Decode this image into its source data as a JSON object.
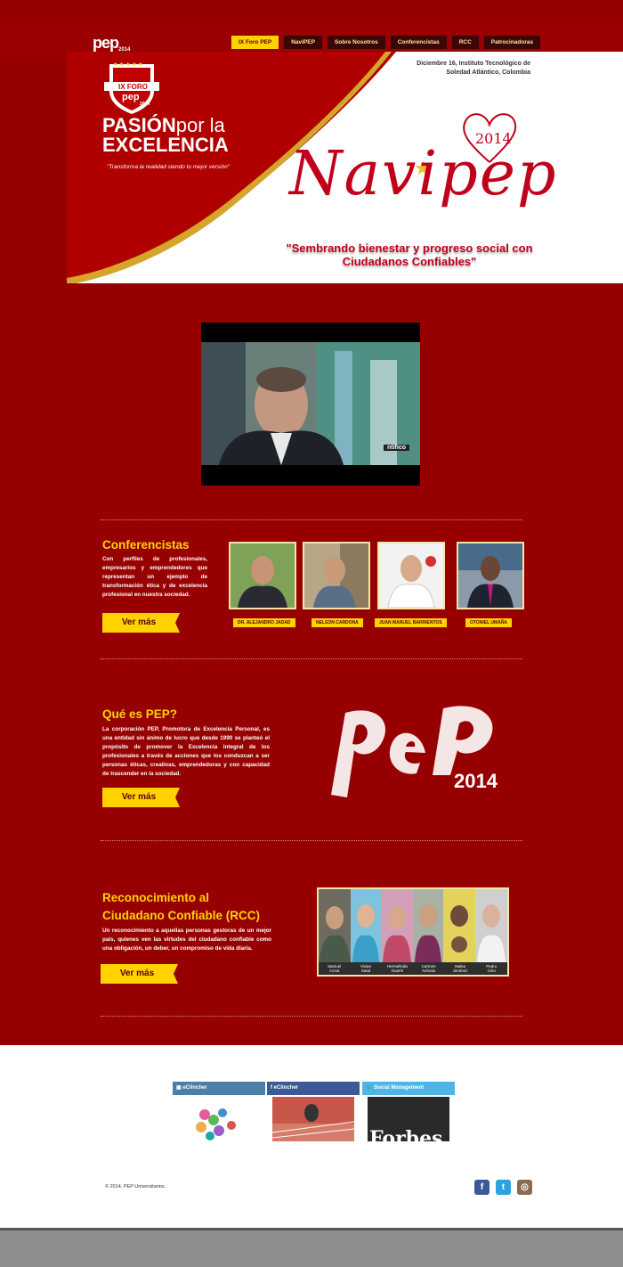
{
  "header": {
    "logo_text": "pep",
    "logo_year": "2014",
    "nav": [
      {
        "label": "IX Foro PEP",
        "active": true
      },
      {
        "label": "NaviPEP",
        "active": false
      },
      {
        "label": "Sobre Nosotros",
        "active": false
      },
      {
        "label": "Conferencistas",
        "active": false
      },
      {
        "label": "RCC",
        "active": false
      },
      {
        "label": "Patrocinadoras",
        "active": false
      }
    ]
  },
  "hero": {
    "badge_text": "IX FORO",
    "badge_pep": "pep",
    "badge_year": "2014",
    "title_bold_1": "PASIÓN",
    "title_light": "por la",
    "title_bold_2": "EXCELENCIA",
    "subtitle": "\"Transforma la realidad siendo tu mejor versión\"",
    "date_line_1": "Diciembre 16, Instituto Tecnológico de",
    "date_line_2": "Soledad Atlántico, Colombia",
    "event_name": "Navipep",
    "event_year": "2014",
    "slogan_line_1": "\"Sembrando bienestar y progreso social con",
    "slogan_line_2": "Ciudadanos Confiables\""
  },
  "video": {
    "caption": "ntífico"
  },
  "conferencistas": {
    "title": "Conferencistas",
    "text": "Con perfiles de profesionales, empresarios y emprendedores que representan un ejemplo de transformación ética y de excelencia profesional en nuestra sociedad.",
    "button": "Ver más",
    "speakers": [
      {
        "name": "DR. ALEJANDRO JADAD"
      },
      {
        "name": "NELSON CARDONA"
      },
      {
        "name": "JUAN MANUEL BARRIENTOS"
      },
      {
        "name": "OTONIEL UMAÑA"
      }
    ]
  },
  "que_es_pep": {
    "title": "Qué es PEP?",
    "text": "La corporación PEP, Promotora de Excelencia Personal, es una entidad sin ánimo de lucro que desde 1990 se planteó el propósito de promover la Excelencia integral de los profesionales a través de acciones que los conduzcan a ser personas éticas, creativas, emprendedoras y con capacidad de trascender en la sociedad.",
    "button": "Ver más",
    "logo_text": "pep",
    "logo_year": "2014"
  },
  "rcc": {
    "title_line_1": "Reconocimiento al",
    "title_line_2": "Ciudadano Confiable (RCC)",
    "text": "Un reconocimiento a aquellas personas gestoras de un mejor país, quienes ven las virtudes del ciudadano confiable como una obligación, un deber, un compromiso de vida diaria.",
    "button": "Ver más",
    "people": [
      {
        "first": "Samuel",
        "last": "Azout"
      },
      {
        "first": "Vivian",
        "last": "Saad"
      },
      {
        "first": "Hermelinda",
        "last": "Guarín"
      },
      {
        "first": "Carmen",
        "last": "Arévalo"
      },
      {
        "first": "Maika",
        "last": "Jiménez"
      },
      {
        "first": "Pedro",
        "last": "Cirio"
      }
    ]
  },
  "feeds": [
    {
      "label": "eClincher",
      "color": "#4a7faa",
      "icon": "linkedin-icon"
    },
    {
      "label": "eClincher",
      "color": "#3b5998",
      "icon": "facebook-icon"
    },
    {
      "label": "Social Management",
      "color": "#4db6e9",
      "icon": "twitter-icon"
    }
  ],
  "feed_images": {
    "forbes": "Forbes"
  },
  "footer": {
    "copyright": "© 2014, PEP Universitarios.",
    "social": [
      {
        "icon": "facebook-icon",
        "glyph": "f",
        "color": "#3b5998"
      },
      {
        "icon": "twitter-icon",
        "glyph": "t",
        "color": "#2aa3e0"
      },
      {
        "icon": "instagram-icon",
        "glyph": "◎",
        "color": "#8a6b4f"
      }
    ]
  }
}
